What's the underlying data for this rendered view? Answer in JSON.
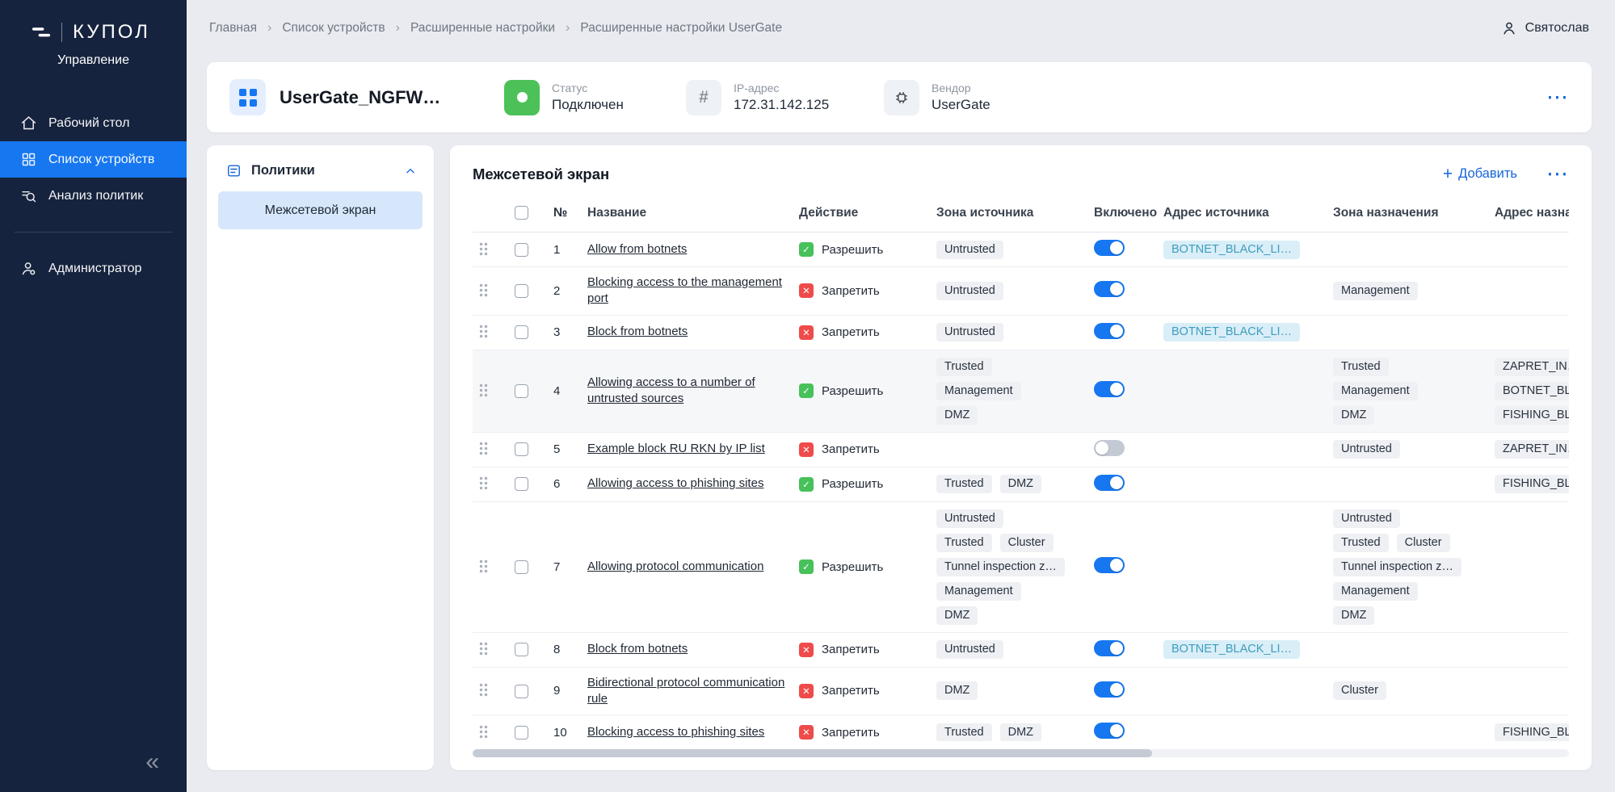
{
  "colors": {
    "accent_blue": "#1677F0",
    "link_blue": "#1565D8",
    "sidebar_bg": "#16233E",
    "allow_green": "#47C159",
    "deny_red": "#EF4B4B",
    "selected_item_bg": "#D7E7FB",
    "address_tag_bg": "#D9EEF7",
    "address_tag_text": "#3E9CBE"
  },
  "sidebar": {
    "logo_title": "КУПОЛ",
    "logo_subtitle": "Управление",
    "menu": [
      {
        "key": "desktop",
        "label": "Рабочий стол",
        "icon": "home-icon",
        "active": false
      },
      {
        "key": "device-list",
        "label": "Список устройств",
        "icon": "devices-grid-icon",
        "active": true
      },
      {
        "key": "policy-analysis",
        "label": "Анализ политик",
        "icon": "policy-analysis-icon",
        "active": false
      }
    ],
    "secondary_menu": [
      {
        "key": "administrator",
        "label": "Администратор",
        "icon": "administrator-icon",
        "active": false
      }
    ],
    "collapse_glyph": "«"
  },
  "topbar": {
    "breadcrumbs": [
      {
        "label": "Главная"
      },
      {
        "label": "Список устройств"
      },
      {
        "label": "Расширенные настройки"
      },
      {
        "label": "Расширенные настройки UserGate"
      }
    ],
    "user_name": "Святослав"
  },
  "device": {
    "title": "UserGate_NGFW…",
    "status": {
      "label": "Статус",
      "value": "Подключен"
    },
    "ip": {
      "label": "IP-адрес",
      "value": "172.31.142.125"
    },
    "vendor": {
      "label": "Вендор",
      "value": "UserGate"
    },
    "menu_glyph": "⋯"
  },
  "policies": {
    "title": "Политики",
    "items": [
      {
        "label": "Межсетевой экран",
        "selected": true
      }
    ]
  },
  "firewall": {
    "title": "Межсетевой экран",
    "add_label": "Добавить",
    "menu_glyph": "⋯",
    "columns": [
      "№",
      "Название",
      "Действие",
      "Зона источника",
      "Включено",
      "Адрес источника",
      "Зона назначения",
      "Адрес назначения"
    ],
    "action_labels": {
      "allow": "Разрешить",
      "deny": "Запретить"
    },
    "rows": [
      {
        "num": "1",
        "name": "Allow from botnets",
        "action": "allow",
        "enabled": true,
        "highlighted": false,
        "src_zones": [
          [
            "Untrusted"
          ]
        ],
        "src_addresses": [
          "BOTNET_BLACK_LI…"
        ],
        "dst_zones": [],
        "dst_addresses": []
      },
      {
        "num": "2",
        "name": "Blocking access to the management port",
        "action": "deny",
        "enabled": true,
        "highlighted": false,
        "src_zones": [
          [
            "Untrusted"
          ]
        ],
        "src_addresses": [],
        "dst_zones": [
          [
            "Management"
          ]
        ],
        "dst_addresses": []
      },
      {
        "num": "3",
        "name": "Block from botnets",
        "action": "deny",
        "enabled": true,
        "highlighted": false,
        "src_zones": [
          [
            "Untrusted"
          ]
        ],
        "src_addresses": [
          "BOTNET_BLACK_LI…"
        ],
        "dst_zones": [],
        "dst_addresses": []
      },
      {
        "num": "4",
        "name": "Allowing access to a number of untrusted sources",
        "action": "allow",
        "enabled": true,
        "highlighted": true,
        "src_zones": [
          [
            "Trusted"
          ],
          [
            "Management"
          ],
          [
            "DMZ"
          ]
        ],
        "src_addresses": [],
        "dst_zones": [
          [
            "Trusted"
          ],
          [
            "Management"
          ],
          [
            "DMZ"
          ]
        ],
        "dst_addresses": [
          "ZAPRET_IN…",
          "BOTNET_BL…",
          "FISHING_BL…"
        ]
      },
      {
        "num": "5",
        "name": "Example block RU RKN by IP list",
        "action": "deny",
        "enabled": false,
        "highlighted": false,
        "src_zones": [],
        "src_addresses": [],
        "dst_zones": [
          [
            "Untrusted"
          ]
        ],
        "dst_addresses": [
          "ZAPRET_IN…"
        ]
      },
      {
        "num": "6",
        "name": "Allowing access to phishing sites",
        "action": "allow",
        "enabled": true,
        "highlighted": false,
        "src_zones": [
          [
            "Trusted",
            "DMZ"
          ]
        ],
        "src_addresses": [],
        "dst_zones": [],
        "dst_addresses": [
          "FISHING_BL…"
        ]
      },
      {
        "num": "7",
        "name": "Allowing protocol communication",
        "action": "allow",
        "enabled": true,
        "highlighted": false,
        "src_zones": [
          [
            "Untrusted"
          ],
          [
            "Trusted",
            "Cluster"
          ],
          [
            "Tunnel inspection z…"
          ],
          [
            "Management"
          ],
          [
            "DMZ"
          ]
        ],
        "src_addresses": [],
        "dst_zones": [
          [
            "Untrusted"
          ],
          [
            "Trusted",
            "Cluster"
          ],
          [
            "Tunnel inspection z…"
          ],
          [
            "Management"
          ],
          [
            "DMZ"
          ]
        ],
        "dst_addresses": []
      },
      {
        "num": "8",
        "name": "Block from botnets",
        "action": "deny",
        "enabled": true,
        "highlighted": false,
        "src_zones": [
          [
            "Untrusted"
          ]
        ],
        "src_addresses": [
          "BOTNET_BLACK_LI…"
        ],
        "dst_zones": [],
        "dst_addresses": []
      },
      {
        "num": "9",
        "name": "Bidirectional protocol communication rule",
        "action": "deny",
        "enabled": true,
        "highlighted": false,
        "src_zones": [
          [
            "DMZ"
          ]
        ],
        "src_addresses": [],
        "dst_zones": [
          [
            "Cluster"
          ]
        ],
        "dst_addresses": []
      },
      {
        "num": "10",
        "name": "Blocking access to phishing sites",
        "action": "deny",
        "enabled": true,
        "highlighted": false,
        "src_zones": [
          [
            "Trusted",
            "DMZ"
          ]
        ],
        "src_addresses": [],
        "dst_zones": [],
        "dst_addresses": [
          "FISHING_BL…"
        ]
      }
    ]
  }
}
